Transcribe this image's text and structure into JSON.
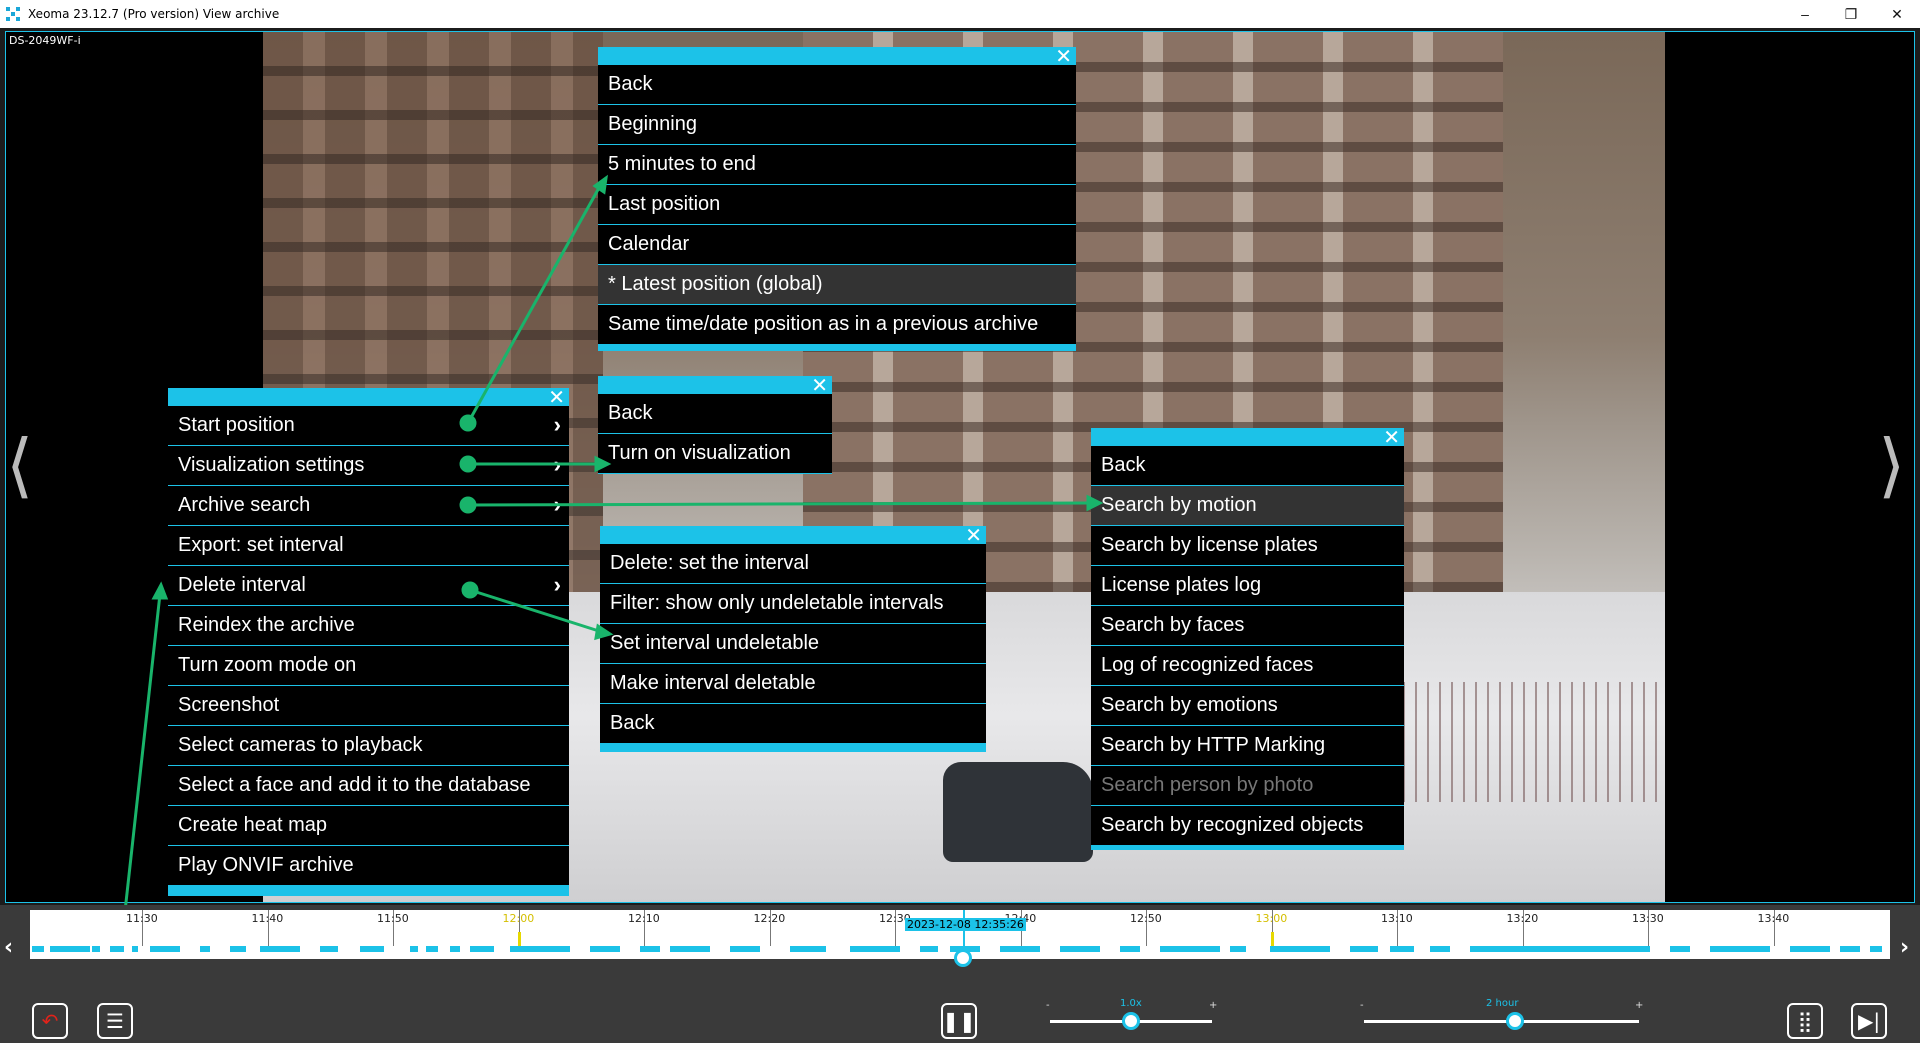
{
  "window": {
    "title": "Xeoma 23.12.7 (Pro version) View archive",
    "minimize": "–",
    "maximize": "❐",
    "close": "✕"
  },
  "camera": {
    "label": "DS-2049WF-i"
  },
  "nav": {
    "prev": "⟨",
    "next": "⟩"
  },
  "main_menu": {
    "close": "✕",
    "items": [
      {
        "label": "Start position",
        "has_sub": true
      },
      {
        "label": "Visualization settings",
        "has_sub": true
      },
      {
        "label": "Archive search",
        "has_sub": true
      },
      {
        "label": "Export: set interval",
        "has_sub": false
      },
      {
        "label": "Delete interval",
        "has_sub": true
      },
      {
        "label": "Reindex the archive",
        "has_sub": false
      },
      {
        "label": "Turn zoom mode on",
        "has_sub": false
      },
      {
        "label": "Screenshot",
        "has_sub": false
      },
      {
        "label": "Select cameras to playback",
        "has_sub": false
      },
      {
        "label": "Select a face and add it to the database",
        "has_sub": false
      },
      {
        "label": "Create heat map",
        "has_sub": false
      },
      {
        "label": "Play ONVIF archive",
        "has_sub": false
      }
    ],
    "chevron": "›"
  },
  "start_menu": {
    "close": "✕",
    "items": [
      "Back",
      "Beginning",
      "5 minutes to end",
      "Last position",
      "Calendar",
      "* Latest position (global)",
      "Same time/date position as in a previous archive"
    ],
    "highlighted": 5
  },
  "vis_menu": {
    "close": "✕",
    "items": [
      "Back",
      "Turn on visualization"
    ]
  },
  "delete_menu": {
    "close": "✕",
    "items": [
      "Delete: set the interval",
      "Filter: show only undeletable intervals",
      "Set interval undeletable",
      "Make interval deletable",
      "Back"
    ]
  },
  "search_menu": {
    "close": "✕",
    "items": [
      "Back",
      "Search by motion",
      "Search by license plates",
      "License plates log",
      "Search by faces",
      "Log of recognized faces",
      "Search by emotions",
      "Search by HTTP Marking",
      "Search person by photo",
      "Search by recognized objects"
    ],
    "highlighted": 1,
    "dimmed": 8
  },
  "timeline": {
    "ticks": [
      "11:30",
      "11:40",
      "11:50",
      "12:00",
      "12:10",
      "12:20",
      "12:30",
      "12:40",
      "12:50",
      "13:00",
      "13:10",
      "13:20",
      "13:30",
      "13:40"
    ],
    "hour_ticks": [
      "12:00",
      "13:00"
    ],
    "current": "2023-12-08 12:35:26",
    "left_arrow": "‹",
    "right_arrow": "›"
  },
  "controls": {
    "back_icon": "undo-arrow-icon",
    "menu_icon": "list-icon",
    "pause_icon": "pause-icon",
    "speed_label": "1.0x",
    "speed_minus": "-",
    "speed_plus": "+",
    "speed_value": 0.5,
    "scale_label": "2 hour",
    "scale_minus": "-",
    "scale_plus": "+",
    "scale_value": 0.55,
    "grid_icon": "grid-icon",
    "skip_end_icon": "skip-to-end-icon"
  },
  "colors": {
    "accent": "#1cc2e8",
    "connector": "#19b46b",
    "hour_mark": "#e6d800"
  }
}
